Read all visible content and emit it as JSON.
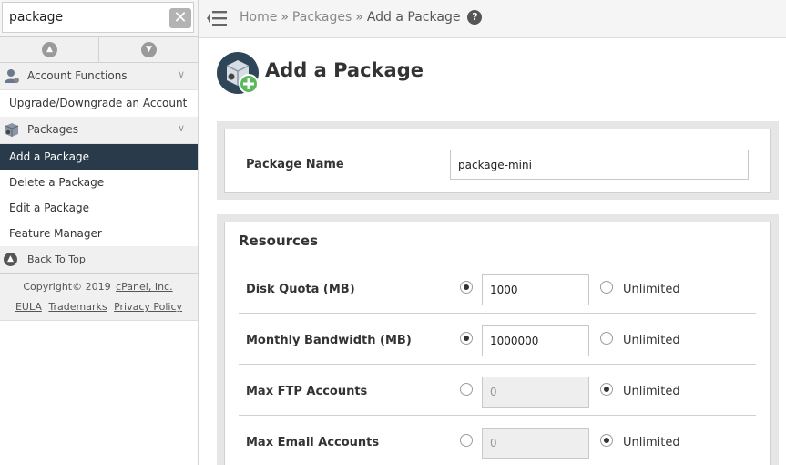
{
  "sidebar": {
    "search": {
      "value": "package",
      "clear_symbol": "✕"
    },
    "account_functions_label": "Account Functions",
    "upgrade_label": "Upgrade/Downgrade an Account",
    "packages_label": "Packages",
    "items": [
      "Add a Package",
      "Delete a Package",
      "Edit a Package",
      "Feature Manager"
    ],
    "active_index": 0,
    "back_to_top": "Back To Top",
    "footer": {
      "copyright_prefix": "Copyright© 2019 ",
      "copyright_link": "cPanel, Inc.",
      "eula": "EULA",
      "trademarks": "Trademarks",
      "privacy": "Privacy Policy"
    }
  },
  "breadcrumb": {
    "home": "Home",
    "packages": "Packages",
    "current": "Add a Package",
    "separator": "»",
    "help_symbol": "?"
  },
  "page": {
    "title": "Add a Package",
    "package_name_label": "Package Name",
    "package_name_value": "package-mini",
    "resources_title": "Resources",
    "unlimited_label": "Unlimited",
    "resources": [
      {
        "label": "Disk Quota (MB)",
        "value": "1000",
        "unlimited": false
      },
      {
        "label": "Monthly Bandwidth (MB)",
        "value": "1000000",
        "unlimited": false
      },
      {
        "label": "Max FTP Accounts",
        "value": "0",
        "unlimited": true
      },
      {
        "label": "Max Email Accounts",
        "value": "0",
        "unlimited": true
      }
    ]
  },
  "colors": {
    "active_bg": "#293a4a",
    "panel_bg": "#e6e6e6",
    "accent_green": "#5cb85c"
  }
}
